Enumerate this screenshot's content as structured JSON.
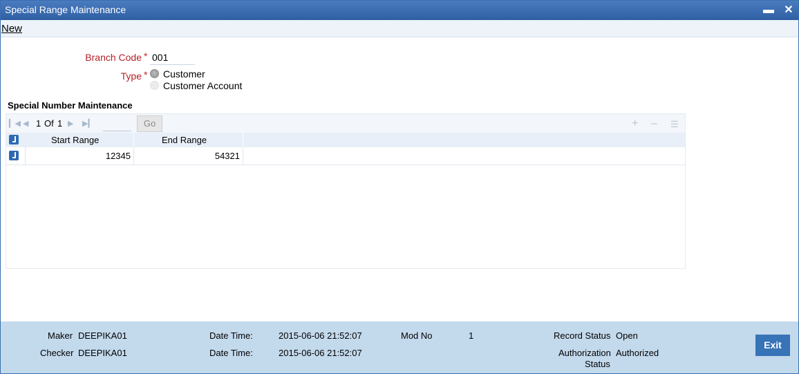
{
  "window": {
    "title": "Special Range Maintenance",
    "minimize_glyph": "▬",
    "close_glyph": "✕"
  },
  "toolbar": {
    "new_label": "New"
  },
  "form": {
    "branch_code_label": "Branch Code",
    "branch_code_value": "001",
    "required_mark": "*",
    "type_label": "Type",
    "type_options": [
      "Customer",
      "Customer Account"
    ],
    "type_selected": "Customer"
  },
  "grid": {
    "section_title": "Special Number Maintenance",
    "page_current": "1",
    "page_of": "Of",
    "page_total": "1",
    "go_label": "Go",
    "columns": [
      "Start Range",
      "End Range"
    ],
    "rows": [
      {
        "start_range": "12345",
        "end_range": "54321"
      }
    ],
    "icons": {
      "first": "first-page-icon",
      "prev": "prev-page-icon",
      "next": "next-page-icon",
      "last": "last-page-icon",
      "add": "add-row-icon",
      "remove": "remove-row-icon",
      "view": "single-view-icon"
    }
  },
  "footer": {
    "maker_label": "Maker",
    "maker_value": "DEEPIKA01",
    "checker_label": "Checker",
    "checker_value": "DEEPIKA01",
    "date_time_label": "Date Time:",
    "maker_date_time": "2015-06-06 21:52:07",
    "checker_date_time": "2015-06-06 21:52:07",
    "mod_no_label": "Mod No",
    "mod_no_value": "1",
    "record_status_label": "Record Status",
    "record_status_value": "Open",
    "auth_status_label_1": "Authorization",
    "auth_status_label_2": "Status",
    "auth_status_value": "Authorized",
    "exit_label": "Exit"
  },
  "colors": {
    "title_bar": "#3a6db4",
    "footer": "#c3d9ec",
    "required": "#b3202a",
    "exit_button": "#3773b7"
  }
}
